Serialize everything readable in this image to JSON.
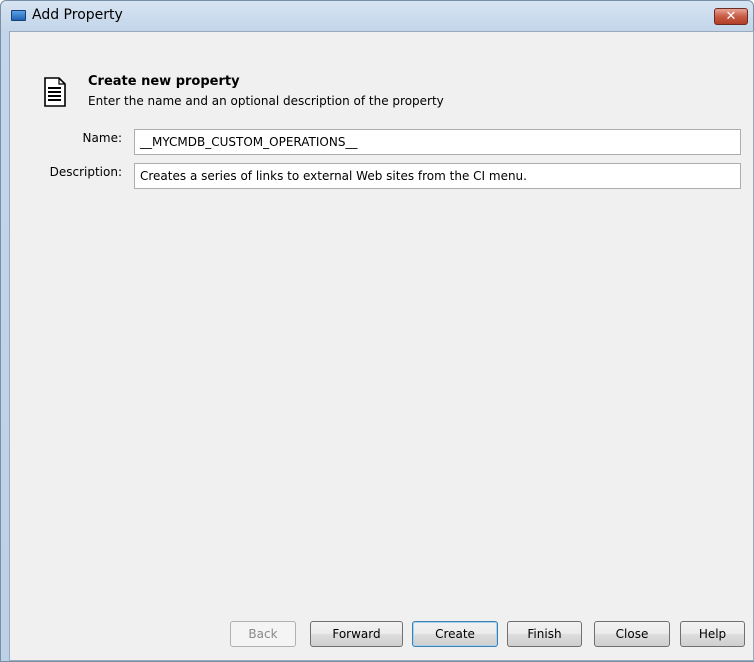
{
  "window": {
    "title": "Add Property",
    "close_label": "✕"
  },
  "header": {
    "title": "Create new property",
    "subtitle": "Enter the name and an optional description of the property",
    "icon": "document-icon"
  },
  "form": {
    "name_label": "Name:",
    "name_value": "__MYCMDB_CUSTOM_OPERATIONS__",
    "description_label": "Description:",
    "description_value": "Creates a series of links to external Web sites from the CI menu."
  },
  "buttons": {
    "back": "Back",
    "forward": "Forward",
    "create": "Create",
    "finish": "Finish",
    "close": "Close",
    "help": "Help"
  },
  "colors": {
    "titlebar": "#c3d5ea",
    "client": "#f0f0f0",
    "close_button": "#c75b46"
  }
}
